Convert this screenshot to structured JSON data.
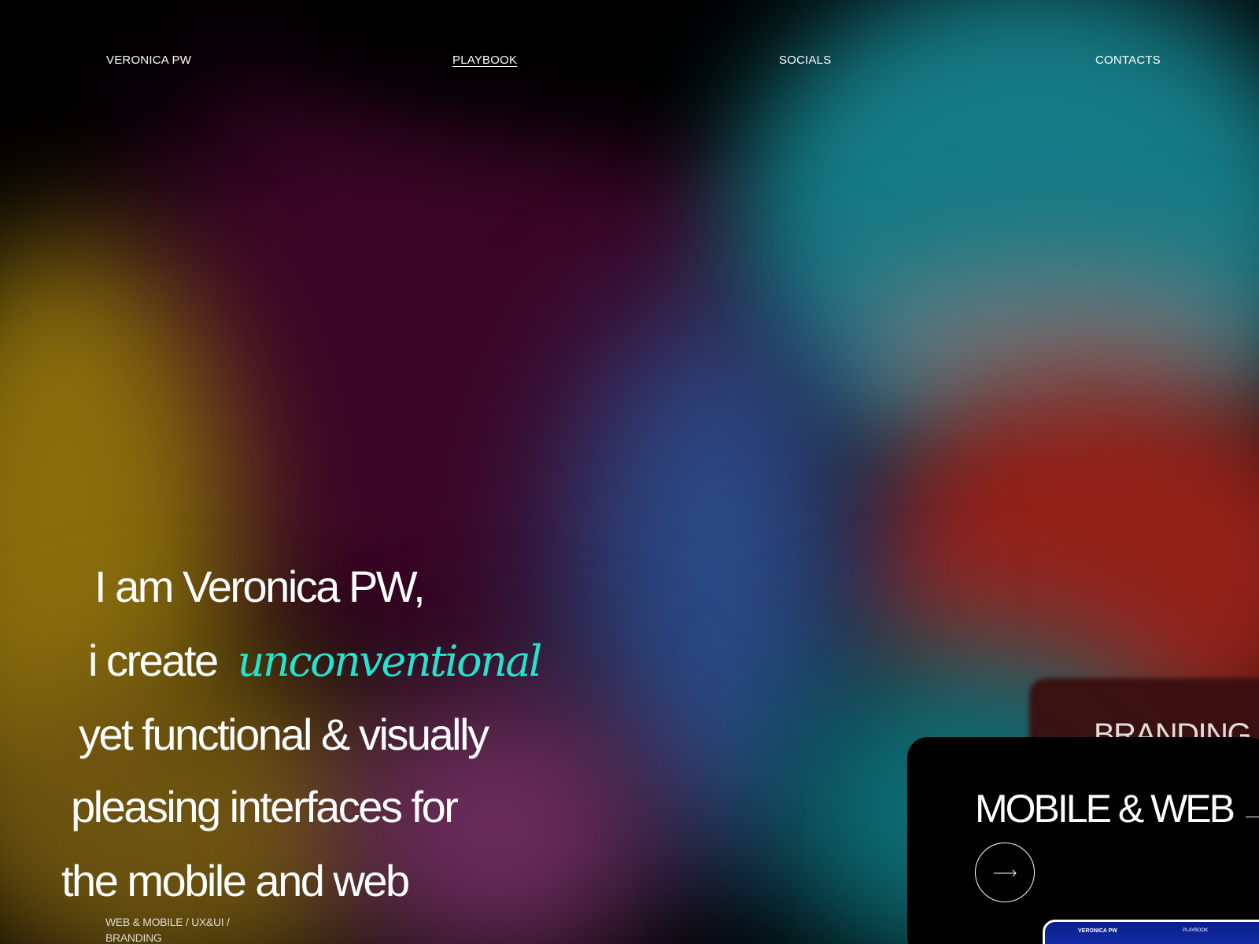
{
  "nav": {
    "logo": "VERONICA PW",
    "links": [
      "PLAYBOOK",
      "SOCIALS",
      "CONTACTS"
    ]
  },
  "hero": {
    "line1": "I am Veronica PW,",
    "line2_prefix": "i create",
    "line2_accent": "unconventional",
    "line3": "yet functional  & visually",
    "line4": "pleasing interfaces for",
    "line5": "the mobile and web",
    "tags_line1": "WEB & MOBILE / UX&UI /",
    "tags_line2": "BRANDING"
  },
  "cards": {
    "branding_label": "BRANDING",
    "mobile_web_title": "MOBILE & WEB",
    "arrow_icon": "arrow-right-icon"
  },
  "preview": {
    "logo": "VERONICA PW",
    "link": "PLAYBOOK"
  },
  "colors": {
    "accent": "#24e3cf",
    "background": "#000000"
  }
}
